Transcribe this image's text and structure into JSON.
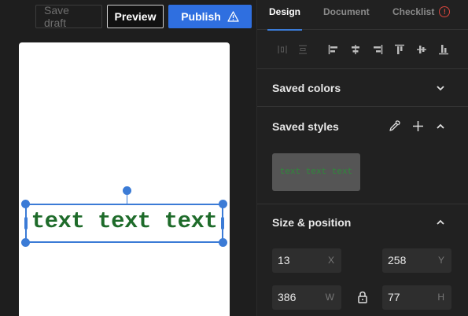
{
  "toolbar": {
    "save_draft": "Save draft",
    "preview": "Preview",
    "publish": "Publish"
  },
  "canvas": {
    "text_element": "text text text"
  },
  "panel": {
    "tabs": {
      "design": "Design",
      "document": "Document",
      "checklist": "Checklist",
      "checklist_badge": "!"
    },
    "saved_colors": {
      "title": "Saved colors"
    },
    "saved_styles": {
      "title": "Saved styles",
      "swatch_text": "text text text"
    },
    "size_position": {
      "title": "Size & position",
      "x": {
        "value": "13",
        "unit": "X"
      },
      "y": {
        "value": "258",
        "unit": "Y"
      },
      "w": {
        "value": "386",
        "unit": "W"
      },
      "h": {
        "value": "77",
        "unit": "H"
      }
    }
  },
  "colors": {
    "accent": "#3b7bd6",
    "publish": "#2f6fe0",
    "text_green": "#1e6b2a",
    "warning": "#d9463d"
  }
}
